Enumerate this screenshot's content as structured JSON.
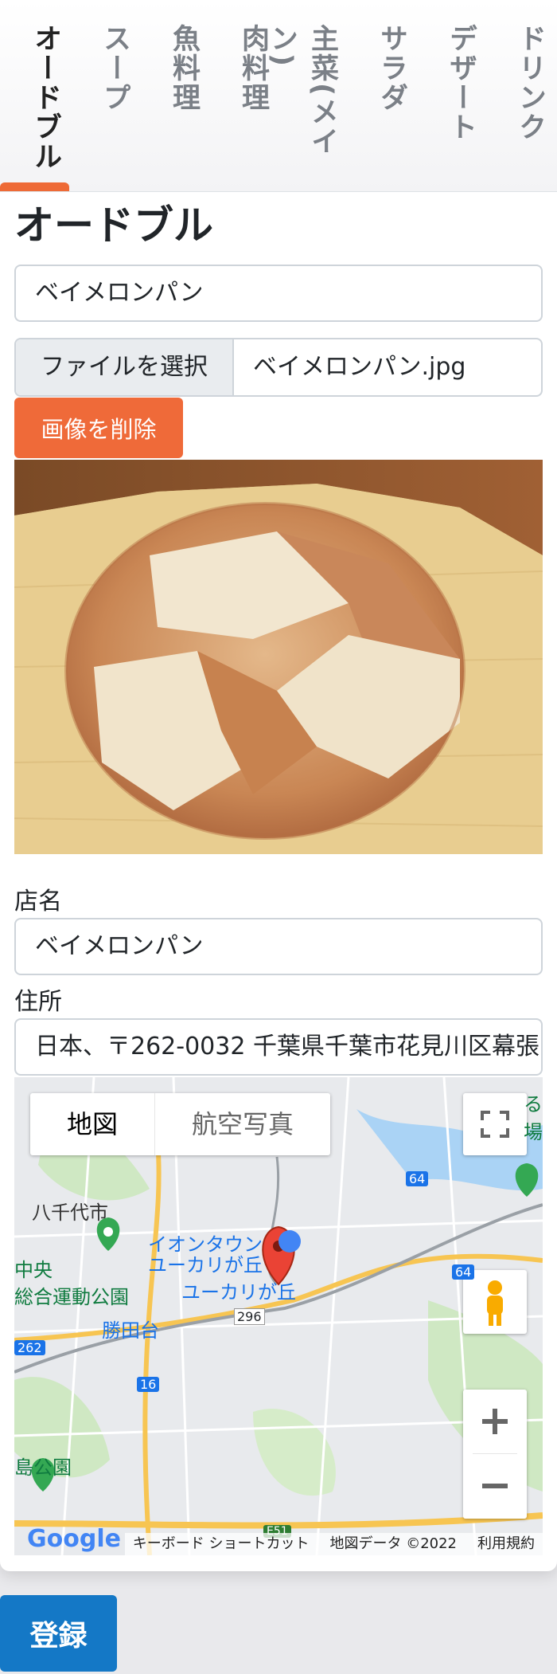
{
  "tabs": [
    {
      "label": "オードブル",
      "active": true
    },
    {
      "label": "スープ",
      "active": false
    },
    {
      "label": "魚料理",
      "active": false
    },
    {
      "label": "肉料理",
      "active": false
    },
    {
      "label": "主菜(メイン)",
      "active": false
    },
    {
      "label": "サラダ",
      "active": false
    },
    {
      "label": "デザート",
      "active": false
    },
    {
      "label": "ドリンク",
      "active": false
    }
  ],
  "section_title": "オードブル",
  "dish_name_value": "ベイメロンパン",
  "file_input": {
    "button_label": "ファイルを選択",
    "file_name": "ベイメロンパン.jpg"
  },
  "delete_image_label": "画像を削除",
  "shop": {
    "label": "店名",
    "value": "ベイメロンパン"
  },
  "address": {
    "label": "住所",
    "value": "日本、〒262-0032 千葉県千葉市花見川区幕張"
  },
  "map": {
    "type_map_label": "地図",
    "type_satellite_label": "航空写真",
    "places": {
      "yachiyo": "八千代市",
      "aeon": "イオンタウン",
      "yukarigaoka": "ユーカリが丘",
      "yukarigaoka_station": "ユーカリが丘",
      "naka": "中央",
      "sogo_park": "総合運動公園",
      "katsutadai": "勝田台",
      "island_park": "島公園",
      "route_296": "296",
      "route_16": "16",
      "route_262": "262",
      "route_64": "64",
      "route_64b": "64",
      "route_e51": "E51",
      "edge_text": "る場"
    },
    "google_logo": "Google",
    "shortcuts": "キーボード ショートカット",
    "map_data": "地図データ ©2022",
    "terms": "利用規約"
  },
  "register_label": "登録",
  "colors": {
    "accent": "#ef6a39",
    "primary": "#1478c6",
    "tab_indicator": "#ee6a36"
  }
}
